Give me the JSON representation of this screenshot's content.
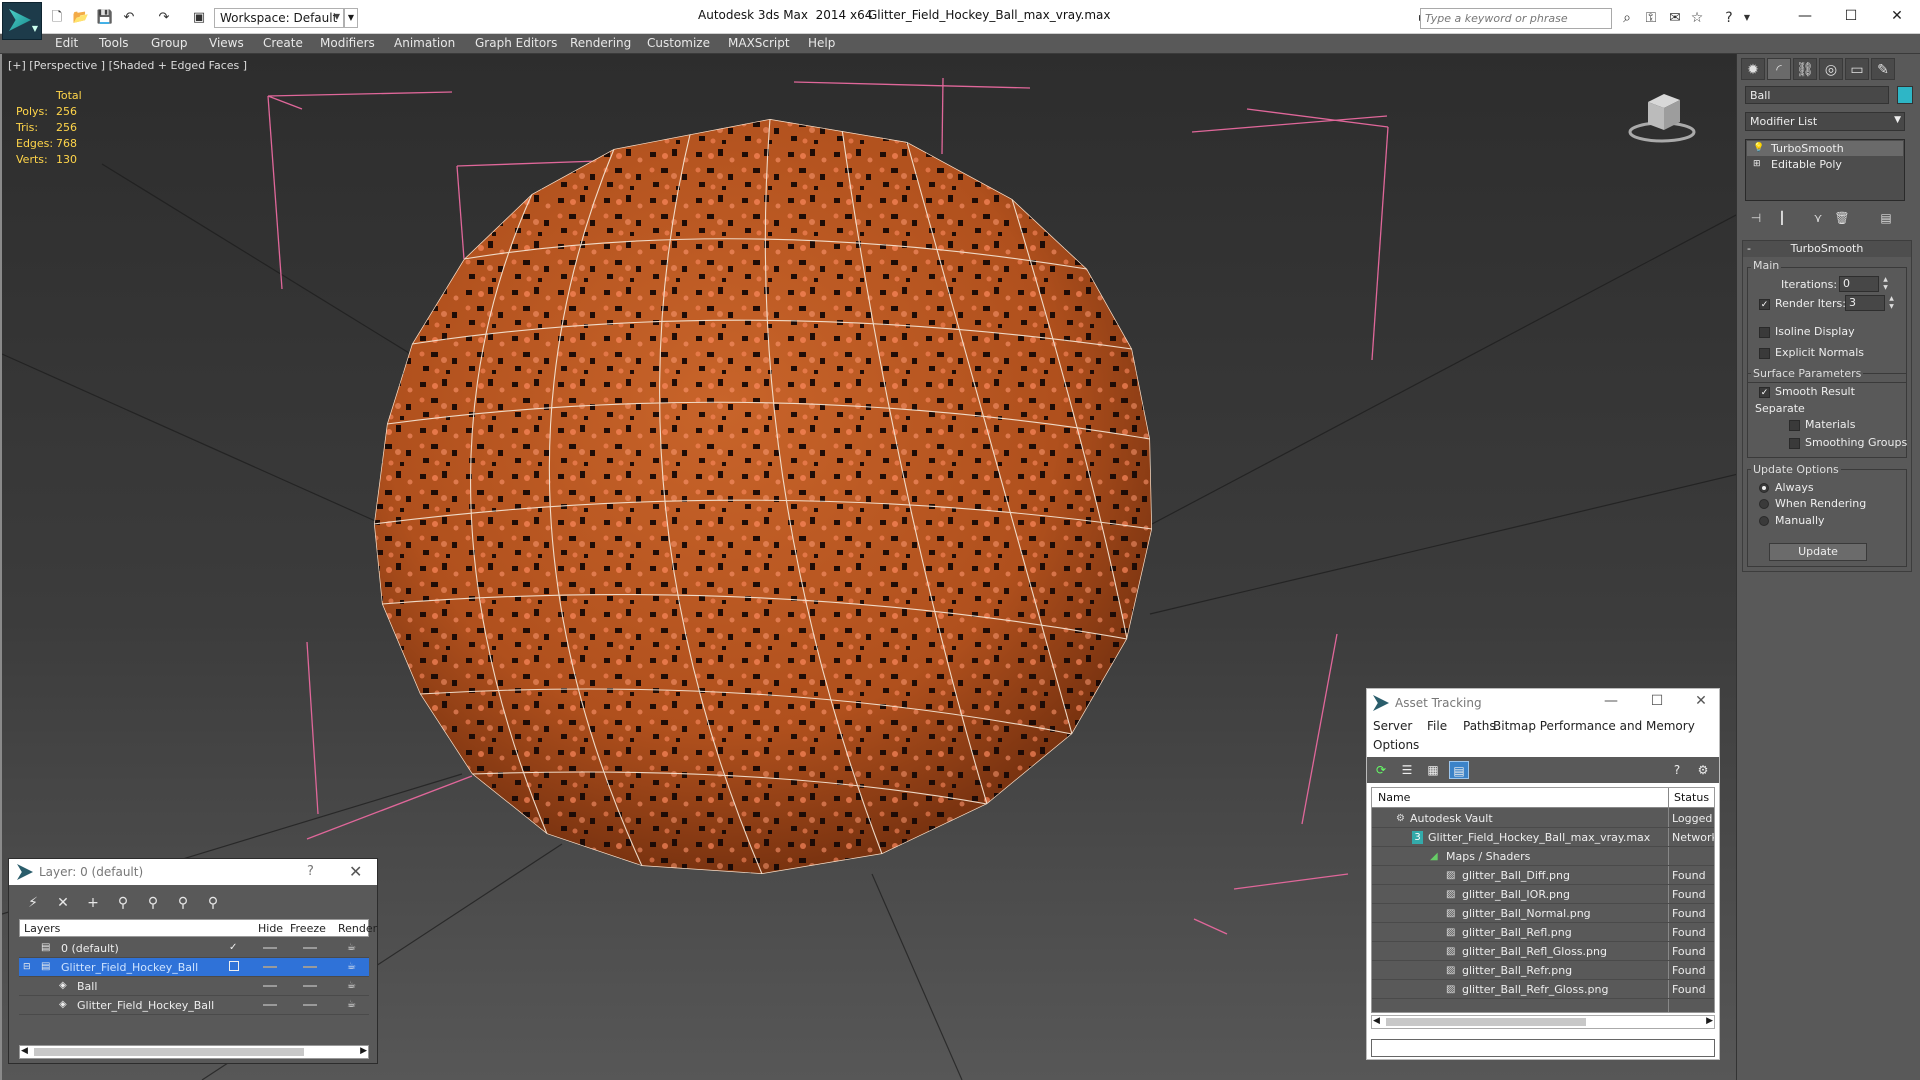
{
  "titlebar": {
    "workspace_label": "Workspace: Default",
    "app_title": "Autodesk 3ds Max  2014 x64",
    "file_title": "Glitter_Field_Hockey_Ball_max_vray.max",
    "search_placeholder": "Type a keyword or phrase"
  },
  "menubar": {
    "items": [
      "Edit",
      "Tools",
      "Group",
      "Views",
      "Create",
      "Modifiers",
      "Animation",
      "Graph Editors",
      "Rendering",
      "Customize",
      "MAXScript",
      "Help"
    ]
  },
  "viewport": {
    "label": "[+] [Perspective ] [Shaded + Edged Faces ]",
    "stats": {
      "header": "Total",
      "rows": [
        {
          "label": "Polys:",
          "value": "256"
        },
        {
          "label": "Tris:",
          "value": "256"
        },
        {
          "label": "Edges:",
          "value": "768"
        },
        {
          "label": "Verts:",
          "value": "130"
        }
      ]
    },
    "colors": {
      "ball": "#b5531e",
      "wire": "#f4e2d0",
      "bbox": "#e0679a",
      "stats": "#ffd54a"
    }
  },
  "command_panel": {
    "object_name": "Ball",
    "object_color": "#2eb6c6",
    "modifier_list": "Modifier List",
    "stack": [
      "TurboSmooth",
      "Editable Poly"
    ],
    "rollout_title": "TurboSmooth",
    "main_group": "Main",
    "iterations_label": "Iterations:",
    "iterations_value": "0",
    "render_iters_label": "Render Iters:",
    "render_iters_value": "3",
    "isoline_label": "Isoline Display",
    "explicit_normals_label": "Explicit Normals",
    "surface_group": "Surface Parameters",
    "smooth_result_label": "Smooth Result",
    "separate_label": "Separate",
    "materials_label": "Materials",
    "smoothing_groups_label": "Smoothing Groups",
    "update_group": "Update Options",
    "always_label": "Always",
    "when_rendering_label": "When Rendering",
    "manually_label": "Manually",
    "update_button": "Update"
  },
  "layer_dialog": {
    "title": "Layer: 0 (default)",
    "help": "?",
    "columns": {
      "layers": "Layers",
      "hide": "Hide",
      "freeze": "Freeze",
      "render": "Render"
    },
    "rows": [
      {
        "name": "0 (default)"
      },
      {
        "name": "Glitter_Field_Hockey_Ball"
      },
      {
        "name": "Ball"
      },
      {
        "name": "Glitter_Field_Hockey_Ball"
      }
    ]
  },
  "asset_dialog": {
    "title": "Asset Tracking",
    "menus": [
      "Server",
      "File",
      "Paths",
      "Bitmap Performance and Memory",
      "Options"
    ],
    "columns": {
      "name": "Name",
      "status": "Status"
    },
    "rows": [
      {
        "name": "Autodesk Vault",
        "status": "Logged O"
      },
      {
        "name": "Glitter_Field_Hockey_Ball_max_vray.max",
        "status": "Network"
      },
      {
        "name": "Maps / Shaders",
        "status": ""
      },
      {
        "name": "glitter_Ball_Diff.png",
        "status": "Found"
      },
      {
        "name": "glitter_Ball_IOR.png",
        "status": "Found"
      },
      {
        "name": "glitter_Ball_Normal.png",
        "status": "Found"
      },
      {
        "name": "glitter_Ball_Refl.png",
        "status": "Found"
      },
      {
        "name": "glitter_Ball_Refl_Gloss.png",
        "status": "Found"
      },
      {
        "name": "glitter_Ball_Refr.png",
        "status": "Found"
      },
      {
        "name": "glitter_Ball_Refr_Gloss.png",
        "status": "Found"
      }
    ]
  }
}
